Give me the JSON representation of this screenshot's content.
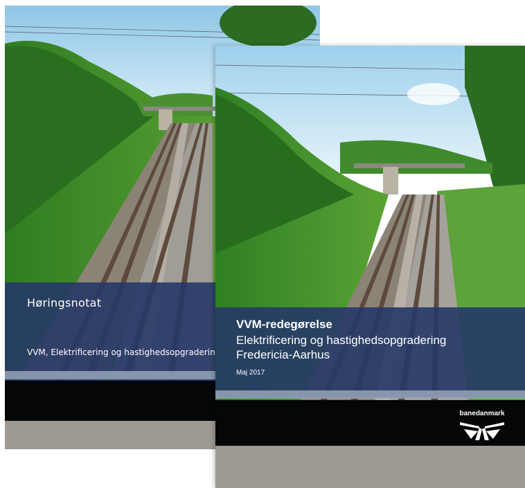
{
  "covers": {
    "back": {
      "title": "Høringsnotat",
      "subtitle": "VVM, Elektrificering og hastighedsopgradering"
    },
    "front": {
      "title": "VVM-redegørelse",
      "subtitle_line1": "Elektrificering og hastighedsopgradering",
      "subtitle_line2": "Fredericia-Aarhus",
      "date": "Maj 2017",
      "brand": "banedanmark"
    }
  },
  "colors": {
    "band": "#263867",
    "sky": "#bfe0f2",
    "grass": "#3e8f2a",
    "rail": "#7a6656"
  }
}
